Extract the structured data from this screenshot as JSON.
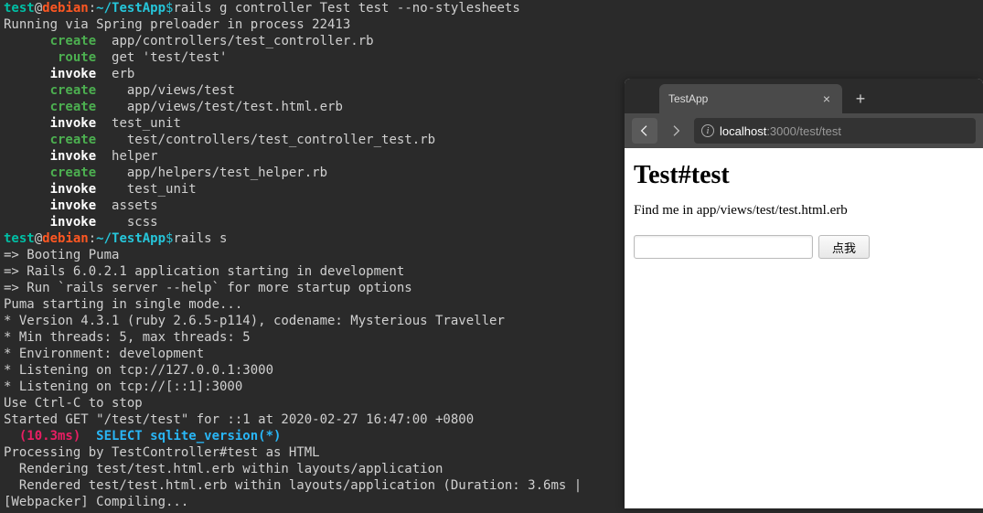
{
  "terminal": {
    "prompt1": {
      "user": "test",
      "host": "debian",
      "path": "~/TestApp",
      "cmd": "rails g controller Test test --no-stylesheets"
    },
    "line_running": "Running via Spring preloader in process 22413",
    "gen": [
      {
        "kw": "create",
        "txt": "  app/controllers/test_controller.rb"
      },
      {
        "kw": "route",
        "txt": "  get 'test/test'"
      },
      {
        "kw": "invoke",
        "txt": "  erb"
      },
      {
        "kw": "create",
        "txt": "    app/views/test"
      },
      {
        "kw": "create",
        "txt": "    app/views/test/test.html.erb"
      },
      {
        "kw": "invoke",
        "txt": "  test_unit"
      },
      {
        "kw": "create",
        "txt": "    test/controllers/test_controller_test.rb"
      },
      {
        "kw": "invoke",
        "txt": "  helper"
      },
      {
        "kw": "create",
        "txt": "    app/helpers/test_helper.rb"
      },
      {
        "kw": "invoke",
        "txt": "    test_unit"
      },
      {
        "kw": "invoke",
        "txt": "  assets"
      },
      {
        "kw": "invoke",
        "txt": "    scss"
      }
    ],
    "prompt2": {
      "user": "test",
      "host": "debian",
      "path": "~/TestApp",
      "cmd": "rails s"
    },
    "boot": [
      "=> Booting Puma",
      "=> Rails 6.0.2.1 application starting in development",
      "=> Run `rails server --help` for more startup options",
      "Puma starting in single mode...",
      "* Version 4.3.1 (ruby 2.6.5-p114), codename: Mysterious Traveller",
      "* Min threads: 5, max threads: 5",
      "* Environment: development",
      "* Listening on tcp://127.0.0.1:3000",
      "* Listening on tcp://[::1]:3000",
      "Use Ctrl-C to stop",
      "Started GET \"/test/test\" for ::1 at 2020-02-27 16:47:00 +0800"
    ],
    "timing": "  (10.3ms)",
    "sql": "  SELECT sqlite_version(*)",
    "tail": [
      "Processing by TestController#test as HTML",
      "  Rendering test/test.html.erb within layouts/application",
      "  Rendered test/test.html.erb within layouts/application (Duration: 3.6ms |",
      "[Webpacker] Compiling..."
    ]
  },
  "browser": {
    "tab_title": "TestApp",
    "close": "×",
    "plus": "+",
    "url_host": "localhost",
    "url_port": ":3000",
    "url_path": "/test/test",
    "page_h1": "Test#test",
    "page_p": "Find me in app/views/test/test.html.erb",
    "button": "点我",
    "info_glyph": "i"
  }
}
